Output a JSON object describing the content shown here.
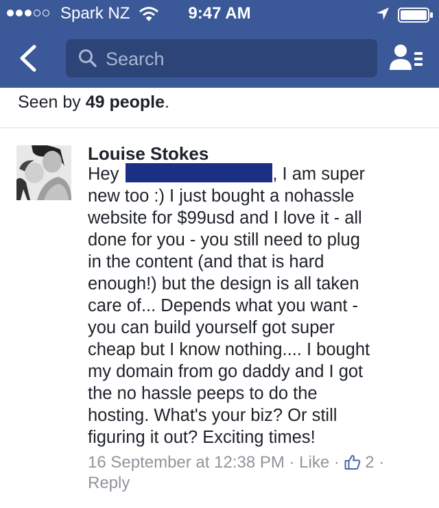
{
  "status_bar": {
    "carrier": "Spark NZ",
    "time": "9:47 AM",
    "signal_bars": 3,
    "signal_total": 5
  },
  "nav": {
    "search_placeholder": "Search",
    "icons": [
      "back-chevron-icon",
      "search-icon",
      "friends-list-icon"
    ]
  },
  "seen": {
    "prefix": "Seen by",
    "count": "49 people",
    "suffix": "."
  },
  "comment": {
    "author": "Louise Stokes",
    "greeting": "Hey",
    "lines": [
      ", I am super",
      "new too :) I just bought a nohassle",
      "website for $99usd and I love it - all",
      "done for you - you still need to plug",
      "in the content (and that is hard",
      "enough!) but the design is all taken",
      "care of... Depends what you want -",
      "you can build yourself got super",
      "cheap but I know nothing.... I bought",
      "my domain from go daddy and I got",
      "the no hassle peeps to do the",
      "hosting. What's your biz? Or still",
      "figuring it out? Exciting times!"
    ],
    "timestamp": "16 September at 12:38 PM",
    "separator": " · ",
    "like_label": "Like",
    "like_count": "2",
    "reply_label": "Reply"
  },
  "colors": {
    "header": "#3b5998",
    "search_box": "#2d4478",
    "meta_text": "#90949c",
    "link_blue": "#4267b2",
    "redaction": "#1b2f86"
  }
}
